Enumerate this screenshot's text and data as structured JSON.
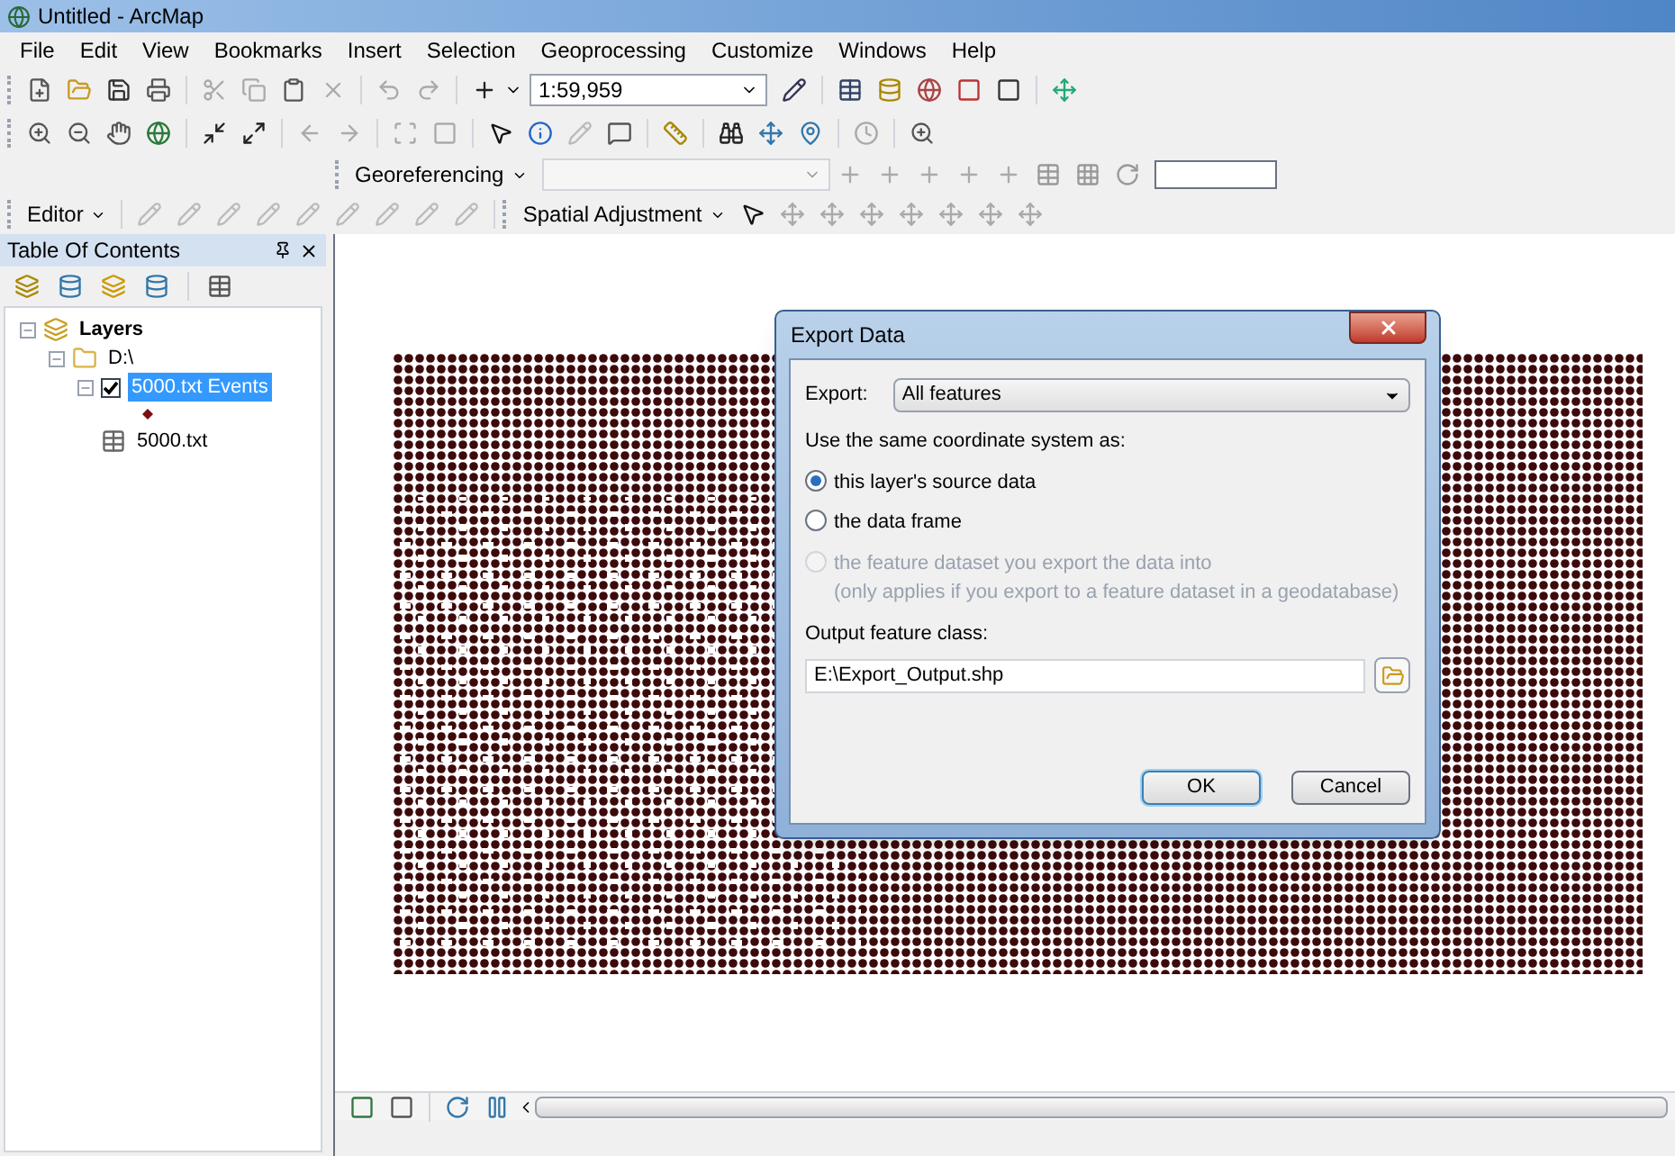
{
  "window": {
    "title": "Untitled - ArcMap"
  },
  "menu": [
    "File",
    "Edit",
    "View",
    "Bookmarks",
    "Insert",
    "Selection",
    "Geoprocessing",
    "Customize",
    "Windows",
    "Help"
  ],
  "toolbar": {
    "scale": "1:59,959",
    "georeferencing": "Georeferencing",
    "editor": "Editor",
    "spatial_adjustment": "Spatial Adjustment"
  },
  "toc": {
    "title": "Table Of Contents",
    "tree": [
      {
        "kind": "group",
        "label": "Layers",
        "expanded": true,
        "children": [
          {
            "kind": "folder",
            "label": "D:\\",
            "expanded": true,
            "children": [
              {
                "kind": "layer",
                "label": "5000.txt Events",
                "expanded": true,
                "checked": true,
                "selected": true
              },
              {
                "kind": "table",
                "label": "5000.txt",
                "selected": false
              }
            ]
          }
        ]
      }
    ]
  },
  "dialog": {
    "title": "Export Data",
    "export_label": "Export:",
    "export_value": "All features",
    "coord_label": "Use the same coordinate system as:",
    "options": [
      {
        "label": "this layer's source data",
        "selected": true,
        "disabled": false
      },
      {
        "label": "the data frame",
        "selected": false,
        "disabled": false
      },
      {
        "label": "the feature dataset you export the data into",
        "note": "(only applies if you export to a feature dataset in a geodatabase)",
        "selected": false,
        "disabled": true
      }
    ],
    "output_label": "Output feature class:",
    "output_value": "E:\\Export_Output.shp",
    "buttons": [
      "OK",
      "Cancel"
    ]
  }
}
